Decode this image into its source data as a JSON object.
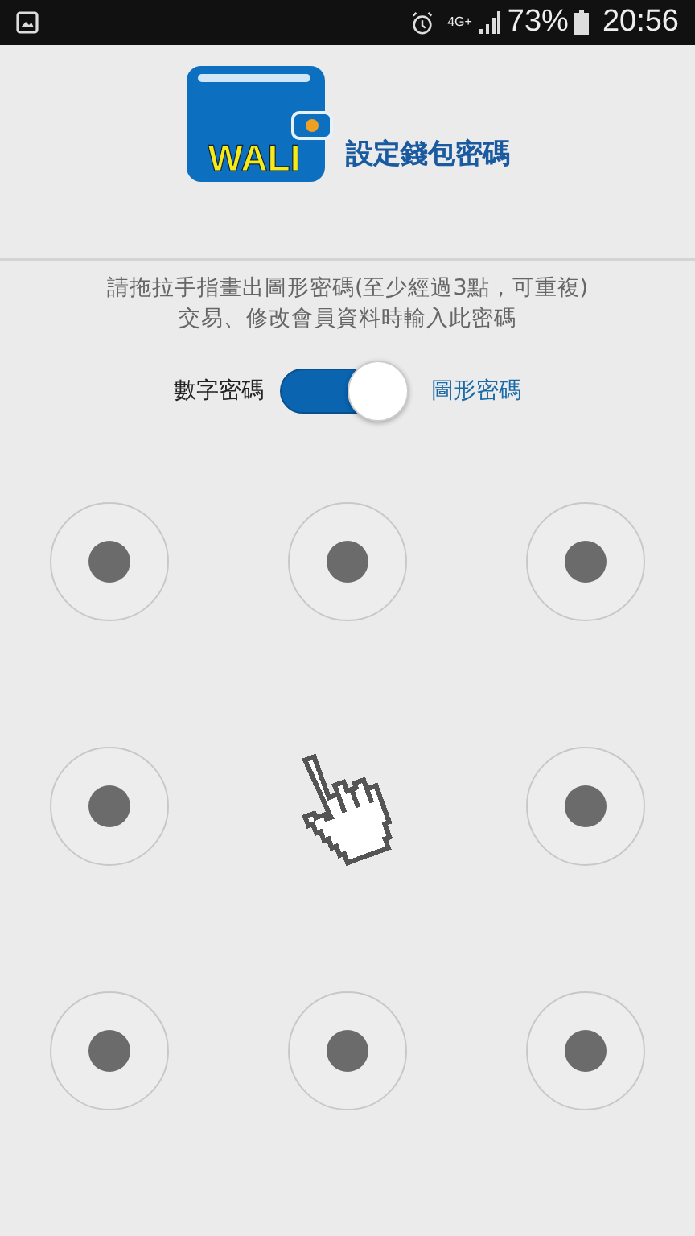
{
  "status_bar": {
    "battery": "73%",
    "time": "20:56",
    "network": "4G+"
  },
  "header": {
    "logo_text": "WALI",
    "title": "設定錢包密碼"
  },
  "instructions": [
    "請拖拉手指畫出圖形密碼(至少經過3點，可重複)",
    "交易、修改會員資料時輸入此密碼"
  ],
  "mode_toggle": {
    "left_label": "數字密碼",
    "right_label": "圖形密碼",
    "on": true
  },
  "pattern_grid": [
    {
      "kind": "dot"
    },
    {
      "kind": "dot"
    },
    {
      "kind": "dot"
    },
    {
      "kind": "dot"
    },
    {
      "kind": "cursor"
    },
    {
      "kind": "dot"
    },
    {
      "kind": "dot"
    },
    {
      "kind": "dot"
    },
    {
      "kind": "dot"
    }
  ]
}
